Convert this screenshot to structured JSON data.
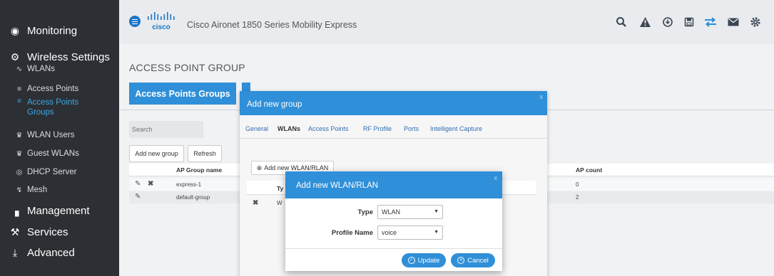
{
  "app": {
    "product_title": "Cisco Aironet 1850 Series Mobility Express",
    "logo_text": "cisco"
  },
  "sidebar": {
    "items": [
      {
        "label": "Monitoring",
        "icon": "dashboard-icon"
      },
      {
        "label": "Wireless Settings",
        "icon": "gear-icon"
      },
      {
        "label": "WLANs",
        "icon": "wifi-icon"
      },
      {
        "label": "Access Points",
        "icon": "access-point-icon"
      },
      {
        "label": "Access Points Groups",
        "icon": "access-point-icon"
      },
      {
        "label": "WLAN Users",
        "icon": "users-icon"
      },
      {
        "label": "Guest WLANs",
        "icon": "users-icon"
      },
      {
        "label": "DHCP Server",
        "icon": "dhcp-icon"
      },
      {
        "label": "Mesh",
        "icon": "mesh-icon"
      },
      {
        "label": "Management",
        "icon": "management-icon"
      },
      {
        "label": "Services",
        "icon": "wrench-icon"
      },
      {
        "label": "Advanced",
        "icon": "download-icon"
      }
    ]
  },
  "header": {
    "icons": [
      "search-icon",
      "alert-icon",
      "download-icon",
      "save-icon",
      "transfer-icon",
      "mail-icon",
      "gear-icon"
    ]
  },
  "page": {
    "title": "ACCESS POINT GROUP",
    "tab_label": "Access Points Groups",
    "search_placeholder": "Search",
    "add_group_label": "Add new group",
    "refresh_label": "Refresh",
    "columns": [
      "AP Group name",
      "AP count"
    ],
    "rows": [
      {
        "name": "express-1",
        "count": "0"
      },
      {
        "name": "default-group",
        "count": "2"
      }
    ]
  },
  "dialog_group": {
    "title": "Add new group",
    "close": "x",
    "tabs": [
      "General",
      "WLANs",
      "Access Points",
      "RF Profile",
      "Ports",
      "Intelligent Capture"
    ],
    "active_tab": "WLANs",
    "add_wlan_label": "Add new WLAN/RLAN",
    "col_type_partial": "Ty",
    "row_partial": "W"
  },
  "dialog_wlan": {
    "title": "Add new WLAN/RLAN",
    "close": "x",
    "type_label": "Type",
    "type_value": "WLAN",
    "profile_label": "Profile Name",
    "profile_value": "voice",
    "update_label": "Update",
    "cancel_label": "Cancel"
  },
  "colors": {
    "accent": "#2f8fd8",
    "sidebar_bg": "#2c2f33",
    "active_nav": "#3da8e6"
  }
}
